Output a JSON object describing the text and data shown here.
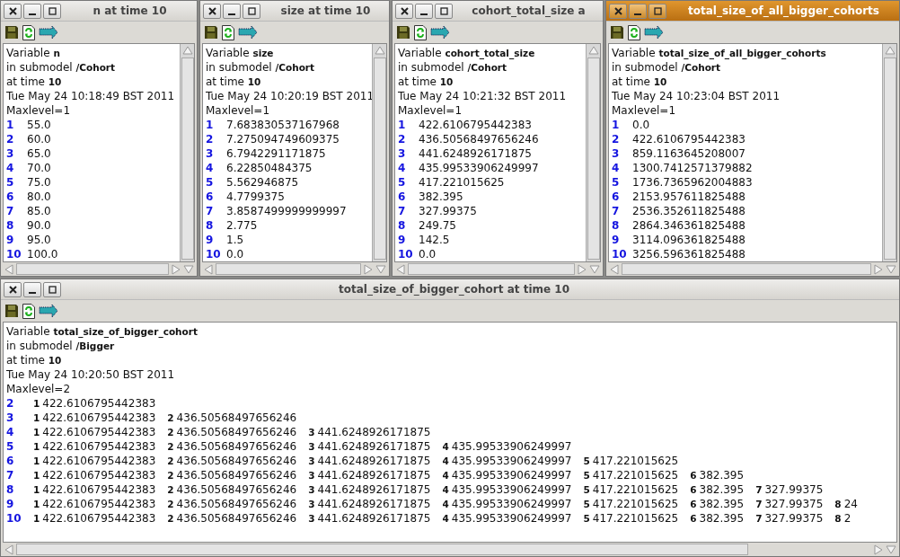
{
  "windows": [
    {
      "title": "n at time 10",
      "active": false,
      "header": [
        "Variable **n**",
        "in submodel **/Cohort**",
        "at time **10**",
        "Tue May 24 10:18:49 BST 2011",
        "Maxlevel=1"
      ],
      "rows": [
        {
          "index": "1",
          "value": "55.0"
        },
        {
          "index": "2",
          "value": "60.0"
        },
        {
          "index": "3",
          "value": "65.0"
        },
        {
          "index": "4",
          "value": "70.0"
        },
        {
          "index": "5",
          "value": "75.0"
        },
        {
          "index": "6",
          "value": "80.0"
        },
        {
          "index": "7",
          "value": "85.0"
        },
        {
          "index": "8",
          "value": "90.0"
        },
        {
          "index": "9",
          "value": "95.0"
        },
        {
          "index": "10",
          "value": "100.0"
        }
      ]
    },
    {
      "title": "size at time 10",
      "active": false,
      "header": [
        "Variable **size**",
        "in submodel **/Cohort**",
        "at time **10**",
        "Tue May 24 10:20:19 BST 2011",
        "Maxlevel=1"
      ],
      "rows": [
        {
          "index": "1",
          "value": "7.683830537167968"
        },
        {
          "index": "2",
          "value": "7.275094749609375"
        },
        {
          "index": "3",
          "value": "6.7942291171875"
        },
        {
          "index": "4",
          "value": "6.22850484375"
        },
        {
          "index": "5",
          "value": "5.562946875"
        },
        {
          "index": "6",
          "value": "4.7799375"
        },
        {
          "index": "7",
          "value": "3.8587499999999997"
        },
        {
          "index": "8",
          "value": "2.775"
        },
        {
          "index": "9",
          "value": "1.5"
        },
        {
          "index": "10",
          "value": "0.0"
        }
      ]
    },
    {
      "title": "cohort_total_size a",
      "active": false,
      "header": [
        "Variable **cohort_total_size**",
        "in submodel **/Cohort**",
        "at time **10**",
        "Tue May 24 10:21:32 BST 2011",
        "Maxlevel=1"
      ],
      "rows": [
        {
          "index": "1",
          "value": "422.6106795442383"
        },
        {
          "index": "2",
          "value": "436.50568497656246"
        },
        {
          "index": "3",
          "value": "441.6248926171875"
        },
        {
          "index": "4",
          "value": "435.99533906249997"
        },
        {
          "index": "5",
          "value": "417.221015625"
        },
        {
          "index": "6",
          "value": "382.395"
        },
        {
          "index": "7",
          "value": "327.99375"
        },
        {
          "index": "8",
          "value": "249.75"
        },
        {
          "index": "9",
          "value": "142.5"
        },
        {
          "index": "10",
          "value": "0.0"
        }
      ]
    },
    {
      "title": "total_size_of_all_bigger_cohorts",
      "active": true,
      "header": [
        "Variable **total_size_of_all_bigger_cohorts**",
        "in submodel **/Cohort**",
        "at time **10**",
        "Tue May 24 10:23:04 BST 2011",
        "Maxlevel=1"
      ],
      "rows": [
        {
          "index": "1",
          "value": "0.0"
        },
        {
          "index": "2",
          "value": "422.6106795442383"
        },
        {
          "index": "3",
          "value": "859.1163645208007"
        },
        {
          "index": "4",
          "value": "1300.7412571379882"
        },
        {
          "index": "5",
          "value": "1736.7365962004883"
        },
        {
          "index": "6",
          "value": "2153.957611825488"
        },
        {
          "index": "7",
          "value": "2536.352611825488"
        },
        {
          "index": "8",
          "value": "2864.346361825488"
        },
        {
          "index": "9",
          "value": "3114.096361825488"
        },
        {
          "index": "10",
          "value": "3256.596361825488"
        }
      ]
    }
  ],
  "bottom_window": {
    "title": "total_size_of_bigger_cohort at time 10",
    "active": false,
    "header": [
      "Variable **total_size_of_bigger_cohort**",
      "in submodel **/Bigger**",
      "at time **10**",
      "Tue May 24 10:20:50 BST 2011",
      "Maxlevel=2"
    ],
    "rows": [
      {
        "index": "2",
        "entries": [
          {
            "index": "1",
            "value": "422.6106795442383"
          }
        ]
      },
      {
        "index": "3",
        "entries": [
          {
            "index": "1",
            "value": "422.6106795442383"
          },
          {
            "index": "2",
            "value": "436.50568497656246"
          }
        ]
      },
      {
        "index": "4",
        "entries": [
          {
            "index": "1",
            "value": "422.6106795442383"
          },
          {
            "index": "2",
            "value": "436.50568497656246"
          },
          {
            "index": "3",
            "value": "441.6248926171875"
          }
        ]
      },
      {
        "index": "5",
        "entries": [
          {
            "index": "1",
            "value": "422.6106795442383"
          },
          {
            "index": "2",
            "value": "436.50568497656246"
          },
          {
            "index": "3",
            "value": "441.6248926171875"
          },
          {
            "index": "4",
            "value": "435.99533906249997"
          }
        ]
      },
      {
        "index": "6",
        "entries": [
          {
            "index": "1",
            "value": "422.6106795442383"
          },
          {
            "index": "2",
            "value": "436.50568497656246"
          },
          {
            "index": "3",
            "value": "441.6248926171875"
          },
          {
            "index": "4",
            "value": "435.99533906249997"
          },
          {
            "index": "5",
            "value": "417.221015625"
          }
        ]
      },
      {
        "index": "7",
        "entries": [
          {
            "index": "1",
            "value": "422.6106795442383"
          },
          {
            "index": "2",
            "value": "436.50568497656246"
          },
          {
            "index": "3",
            "value": "441.6248926171875"
          },
          {
            "index": "4",
            "value": "435.99533906249997"
          },
          {
            "index": "5",
            "value": "417.221015625"
          },
          {
            "index": "6",
            "value": "382.395"
          }
        ]
      },
      {
        "index": "8",
        "entries": [
          {
            "index": "1",
            "value": "422.6106795442383"
          },
          {
            "index": "2",
            "value": "436.50568497656246"
          },
          {
            "index": "3",
            "value": "441.6248926171875"
          },
          {
            "index": "4",
            "value": "435.99533906249997"
          },
          {
            "index": "5",
            "value": "417.221015625"
          },
          {
            "index": "6",
            "value": "382.395"
          },
          {
            "index": "7",
            "value": "327.99375"
          }
        ]
      },
      {
        "index": "9",
        "entries": [
          {
            "index": "1",
            "value": "422.6106795442383"
          },
          {
            "index": "2",
            "value": "436.50568497656246"
          },
          {
            "index": "3",
            "value": "441.6248926171875"
          },
          {
            "index": "4",
            "value": "435.99533906249997"
          },
          {
            "index": "5",
            "value": "417.221015625"
          },
          {
            "index": "6",
            "value": "382.395"
          },
          {
            "index": "7",
            "value": "327.99375"
          },
          {
            "index": "8",
            "value": "24"
          }
        ]
      },
      {
        "index": "10",
        "entries": [
          {
            "index": "1",
            "value": "422.6106795442383"
          },
          {
            "index": "2",
            "value": "436.50568497656246"
          },
          {
            "index": "3",
            "value": "441.6248926171875"
          },
          {
            "index": "4",
            "value": "435.99533906249997"
          },
          {
            "index": "5",
            "value": "417.221015625"
          },
          {
            "index": "6",
            "value": "382.395"
          },
          {
            "index": "7",
            "value": "327.99375"
          },
          {
            "index": "8",
            "value": "2"
          }
        ]
      }
    ]
  }
}
